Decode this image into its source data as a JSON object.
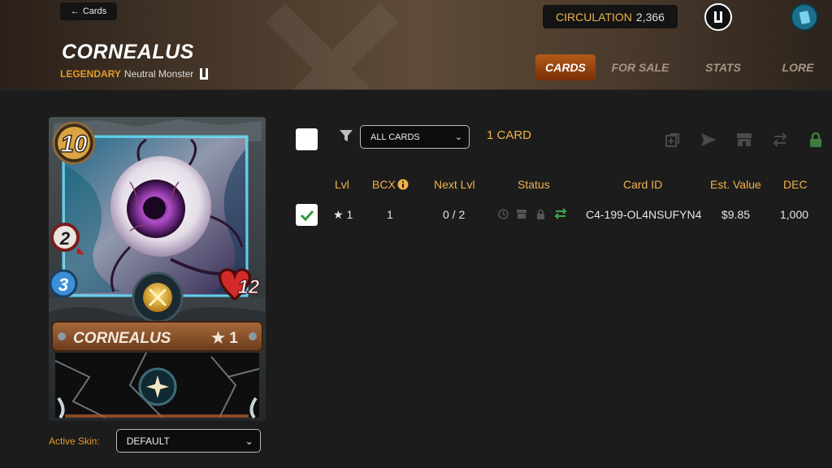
{
  "header": {
    "back_label": "Cards",
    "title": "CORNEALUS",
    "rarity": "LEGENDARY",
    "type": "Neutral Monster",
    "circulation_label": "CIRCULATION",
    "circulation_value": "2,366",
    "tabs": [
      {
        "label": "CARDS",
        "active": true
      },
      {
        "label": "FOR SALE",
        "active": false
      },
      {
        "label": "STATS",
        "active": false
      },
      {
        "label": "LORE",
        "active": false
      }
    ]
  },
  "card": {
    "mana": "10",
    "attack": "2",
    "speed": "3",
    "health": "12",
    "name": "CORNEALUS",
    "level": "★ 1"
  },
  "skin": {
    "label": "Active Skin:",
    "value": "DEFAULT"
  },
  "toolbar": {
    "filter_value": "ALL CARDS",
    "count": "1 CARD"
  },
  "table": {
    "headers": {
      "lvl": "Lvl",
      "bcx": "BCX",
      "next_lvl": "Next Lvl",
      "status": "Status",
      "card_id": "Card ID",
      "est_value": "Est. Value",
      "dec": "DEC"
    },
    "rows": [
      {
        "lvl": "★ 1",
        "bcx": "1",
        "next_lvl": "0 / 2",
        "card_id": "C4-199-OL4NSUFYN4",
        "est_value": "$9.85",
        "dec": "1,000"
      }
    ]
  },
  "colors": {
    "accent": "#f0b24b",
    "rarity": "#e59b2a",
    "tab_active": "#b35b18"
  }
}
